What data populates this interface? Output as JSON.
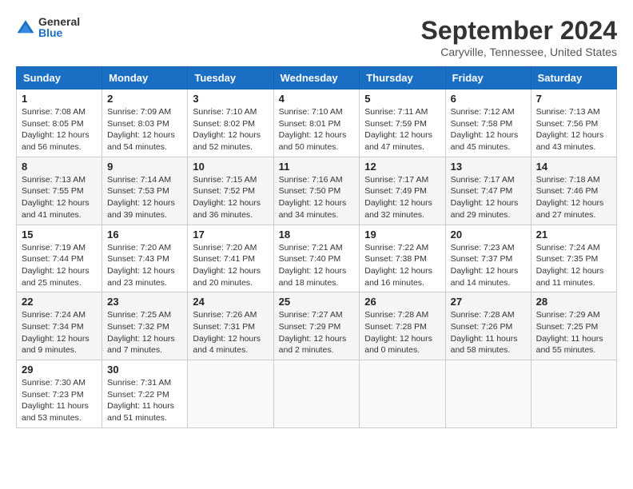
{
  "header": {
    "logo_general": "General",
    "logo_blue": "Blue",
    "month_title": "September 2024",
    "location": "Caryville, Tennessee, United States"
  },
  "weekdays": [
    "Sunday",
    "Monday",
    "Tuesday",
    "Wednesday",
    "Thursday",
    "Friday",
    "Saturday"
  ],
  "weeks": [
    [
      {
        "day": "1",
        "info": "Sunrise: 7:08 AM\nSunset: 8:05 PM\nDaylight: 12 hours\nand 56 minutes."
      },
      {
        "day": "2",
        "info": "Sunrise: 7:09 AM\nSunset: 8:03 PM\nDaylight: 12 hours\nand 54 minutes."
      },
      {
        "day": "3",
        "info": "Sunrise: 7:10 AM\nSunset: 8:02 PM\nDaylight: 12 hours\nand 52 minutes."
      },
      {
        "day": "4",
        "info": "Sunrise: 7:10 AM\nSunset: 8:01 PM\nDaylight: 12 hours\nand 50 minutes."
      },
      {
        "day": "5",
        "info": "Sunrise: 7:11 AM\nSunset: 7:59 PM\nDaylight: 12 hours\nand 47 minutes."
      },
      {
        "day": "6",
        "info": "Sunrise: 7:12 AM\nSunset: 7:58 PM\nDaylight: 12 hours\nand 45 minutes."
      },
      {
        "day": "7",
        "info": "Sunrise: 7:13 AM\nSunset: 7:56 PM\nDaylight: 12 hours\nand 43 minutes."
      }
    ],
    [
      {
        "day": "8",
        "info": "Sunrise: 7:13 AM\nSunset: 7:55 PM\nDaylight: 12 hours\nand 41 minutes."
      },
      {
        "day": "9",
        "info": "Sunrise: 7:14 AM\nSunset: 7:53 PM\nDaylight: 12 hours\nand 39 minutes."
      },
      {
        "day": "10",
        "info": "Sunrise: 7:15 AM\nSunset: 7:52 PM\nDaylight: 12 hours\nand 36 minutes."
      },
      {
        "day": "11",
        "info": "Sunrise: 7:16 AM\nSunset: 7:50 PM\nDaylight: 12 hours\nand 34 minutes."
      },
      {
        "day": "12",
        "info": "Sunrise: 7:17 AM\nSunset: 7:49 PM\nDaylight: 12 hours\nand 32 minutes."
      },
      {
        "day": "13",
        "info": "Sunrise: 7:17 AM\nSunset: 7:47 PM\nDaylight: 12 hours\nand 29 minutes."
      },
      {
        "day": "14",
        "info": "Sunrise: 7:18 AM\nSunset: 7:46 PM\nDaylight: 12 hours\nand 27 minutes."
      }
    ],
    [
      {
        "day": "15",
        "info": "Sunrise: 7:19 AM\nSunset: 7:44 PM\nDaylight: 12 hours\nand 25 minutes."
      },
      {
        "day": "16",
        "info": "Sunrise: 7:20 AM\nSunset: 7:43 PM\nDaylight: 12 hours\nand 23 minutes."
      },
      {
        "day": "17",
        "info": "Sunrise: 7:20 AM\nSunset: 7:41 PM\nDaylight: 12 hours\nand 20 minutes."
      },
      {
        "day": "18",
        "info": "Sunrise: 7:21 AM\nSunset: 7:40 PM\nDaylight: 12 hours\nand 18 minutes."
      },
      {
        "day": "19",
        "info": "Sunrise: 7:22 AM\nSunset: 7:38 PM\nDaylight: 12 hours\nand 16 minutes."
      },
      {
        "day": "20",
        "info": "Sunrise: 7:23 AM\nSunset: 7:37 PM\nDaylight: 12 hours\nand 14 minutes."
      },
      {
        "day": "21",
        "info": "Sunrise: 7:24 AM\nSunset: 7:35 PM\nDaylight: 12 hours\nand 11 minutes."
      }
    ],
    [
      {
        "day": "22",
        "info": "Sunrise: 7:24 AM\nSunset: 7:34 PM\nDaylight: 12 hours\nand 9 minutes."
      },
      {
        "day": "23",
        "info": "Sunrise: 7:25 AM\nSunset: 7:32 PM\nDaylight: 12 hours\nand 7 minutes."
      },
      {
        "day": "24",
        "info": "Sunrise: 7:26 AM\nSunset: 7:31 PM\nDaylight: 12 hours\nand 4 minutes."
      },
      {
        "day": "25",
        "info": "Sunrise: 7:27 AM\nSunset: 7:29 PM\nDaylight: 12 hours\nand 2 minutes."
      },
      {
        "day": "26",
        "info": "Sunrise: 7:28 AM\nSunset: 7:28 PM\nDaylight: 12 hours\nand 0 minutes."
      },
      {
        "day": "27",
        "info": "Sunrise: 7:28 AM\nSunset: 7:26 PM\nDaylight: 11 hours\nand 58 minutes."
      },
      {
        "day": "28",
        "info": "Sunrise: 7:29 AM\nSunset: 7:25 PM\nDaylight: 11 hours\nand 55 minutes."
      }
    ],
    [
      {
        "day": "29",
        "info": "Sunrise: 7:30 AM\nSunset: 7:23 PM\nDaylight: 11 hours\nand 53 minutes."
      },
      {
        "day": "30",
        "info": "Sunrise: 7:31 AM\nSunset: 7:22 PM\nDaylight: 11 hours\nand 51 minutes."
      },
      null,
      null,
      null,
      null,
      null
    ]
  ]
}
